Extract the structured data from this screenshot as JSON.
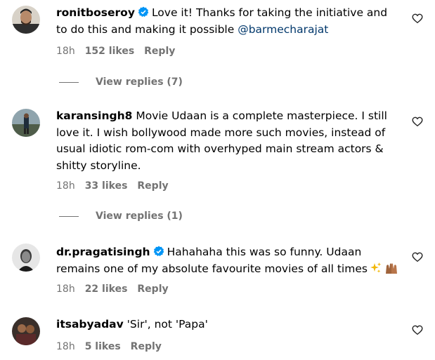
{
  "comments": [
    {
      "username": "ronitboseroy",
      "verified": true,
      "text": "Love it! Thanks for taking the initiative and to do this and making it possible ",
      "mention": "@barmecharajat",
      "time": "18h",
      "likes": "152 likes",
      "reply": "Reply",
      "view_replies": "View replies (7)"
    },
    {
      "username": "karansingh8",
      "verified": false,
      "text": "Movie Udaan is a complete masterpiece. I still love it. I wish bollywood made more such movies, instead of usual idiotic rom-com with overhyped main stream actors & shitty storyline.",
      "time": "18h",
      "likes": "33 likes",
      "reply": "Reply",
      "view_replies": "View replies (1)"
    },
    {
      "username": "dr.pragatisingh",
      "verified": true,
      "text": "Hahahaha this was so funny. Udaan remains one of my absolute favourite movies of all times",
      "time": "18h",
      "likes": "22 likes",
      "reply": "Reply"
    },
    {
      "username": "itsabyadav",
      "verified": false,
      "text": "'Sir', not 'Papa'",
      "time": "18h",
      "likes": "5 likes",
      "reply": "Reply"
    }
  ],
  "colors": {
    "muted": "#737373",
    "verified": "#0095f6",
    "mention": "#00376b"
  },
  "icons": [
    "heart-icon",
    "verified-badge-icon",
    "sparkles-icon",
    "hands-icon"
  ]
}
